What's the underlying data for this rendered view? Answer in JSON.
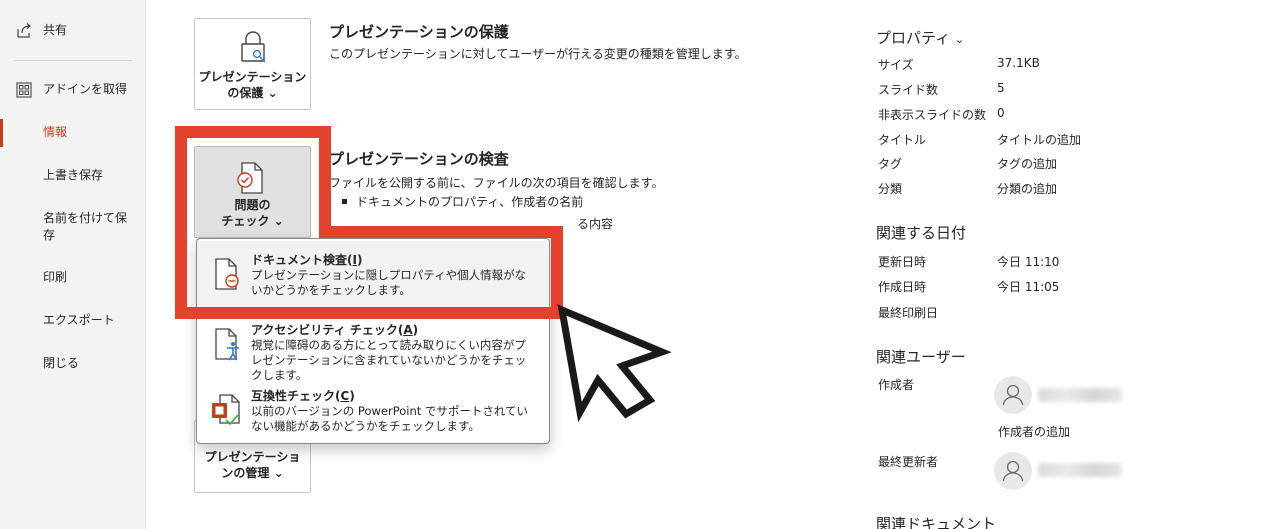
{
  "sidebar": {
    "items": [
      {
        "label": "共有",
        "icon": "share-icon"
      },
      {
        "label": "アドインを取得",
        "icon": "addins-icon"
      },
      {
        "label": "情報",
        "active": true
      },
      {
        "label": "上書き保存"
      },
      {
        "label": "名前を付けて保存"
      },
      {
        "label": "印刷"
      },
      {
        "label": "エクスポート"
      },
      {
        "label": "閉じる"
      }
    ],
    "accent": "#c43e1c"
  },
  "protect": {
    "button_line1": "プレゼンテーション",
    "button_line2": "の保護",
    "title": "プレゼンテーションの保護",
    "desc": "このプレゼンテーションに対してユーザーが行える変更の種類を管理します。"
  },
  "inspect": {
    "button_line1": "問題の",
    "button_line2": "チェック",
    "title": "プレゼンテーションの検査",
    "desc": "ファイルを公開する前に、ファイルの次の項目を確認します。",
    "bullets": [
      "ドキュメントのプロパティ、作成者の名前",
      "る内容"
    ]
  },
  "manage": {
    "button_line1": "プレゼンテーショ",
    "button_line2": "ンの管理"
  },
  "chevron": "⌄",
  "dropdown": {
    "items": [
      {
        "title": "ドキュメント検査(",
        "key": "I",
        "title_end": ")",
        "desc": "プレゼンテーションに隠しプロパティや個人情報がないかどうかをチェックします。"
      },
      {
        "title": "アクセシビリティ チェック(",
        "key": "A",
        "title_end": ")",
        "desc": "視覚に障碍のある方にとって読み取りにくい内容がプレゼンテーションに含まれていないかどうかをチェックします。"
      },
      {
        "title": "互換性チェック(",
        "key": "C",
        "title_end": ")",
        "desc": "以前のバージョンの PowerPoint でサポートされていない機能があるかどうかをチェックします。"
      }
    ]
  },
  "properties": {
    "heading": "プロパティ",
    "rows": [
      {
        "key": "サイズ",
        "value": "37.1KB"
      },
      {
        "key": "スライド数",
        "value": "5"
      },
      {
        "key": "非表示スライドの数",
        "value": "0"
      },
      {
        "key": "タイトル",
        "value": "タイトルの追加"
      },
      {
        "key": "タグ",
        "value": "タグの追加"
      },
      {
        "key": "分類",
        "value": "分類の追加"
      }
    ]
  },
  "dates": {
    "heading": "関連する日付",
    "rows": [
      {
        "key": "更新日時",
        "value": "今日 11:10"
      },
      {
        "key": "作成日時",
        "value": "今日 11:05"
      },
      {
        "key": "最終印刷日",
        "value": ""
      }
    ]
  },
  "users": {
    "heading": "関連ユーザー",
    "author_label": "作成者",
    "add_author": "作成者の追加",
    "modifier_label": "最終更新者"
  },
  "documents": {
    "heading": "関連ドキュメント"
  },
  "colors": {
    "highlight": "#e5422e",
    "text": "#262626"
  }
}
